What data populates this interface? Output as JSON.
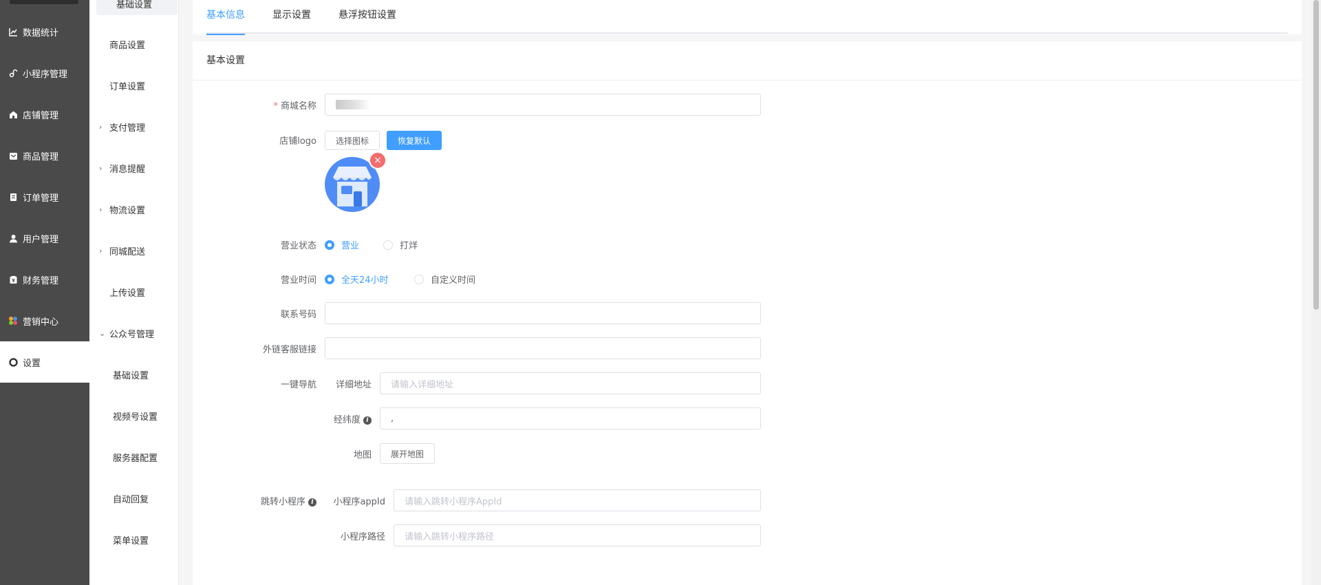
{
  "sidebar": {
    "items": [
      {
        "label": "数据统计",
        "icon": "chart-line-icon"
      },
      {
        "label": "小程序管理",
        "icon": "link-icon"
      },
      {
        "label": "店铺管理",
        "icon": "store-icon"
      },
      {
        "label": "商品管理",
        "icon": "product-icon"
      },
      {
        "label": "订单管理",
        "icon": "order-icon"
      },
      {
        "label": "用户管理",
        "icon": "user-icon"
      },
      {
        "label": "财务管理",
        "icon": "finance-icon"
      },
      {
        "label": "营销中心",
        "icon": "marketing-icon"
      },
      {
        "label": "设置",
        "icon": "gear-icon"
      }
    ]
  },
  "subnav": {
    "selected": "基础设置",
    "items": [
      "商品设置",
      "订单设置",
      "支付管理",
      "消息提醒",
      "物流设置",
      "同城配送",
      "上传设置",
      "公众号管理",
      "基础设置",
      "视频号设置",
      "服务器配置",
      "自动回复",
      "菜单设置"
    ]
  },
  "tabs": [
    "基本信息",
    "显示设置",
    "悬浮按钮设置"
  ],
  "card_title": "基本设置",
  "form": {
    "shop_name_label": "商城名称",
    "logo_label": "店铺logo",
    "choose_icon_btn": "选择图标",
    "restore_default_btn": "恢复默认",
    "status_label": "营业状态",
    "status_open": "营业",
    "status_closed": "打烊",
    "hours_label": "营业时间",
    "hours_all_day": "全天24小时",
    "hours_custom": "自定义时间",
    "phone_label": "联系号码",
    "cs_link_label": "外链客服链接",
    "nav_label": "一键导航",
    "address_label": "详细地址",
    "address_placeholder": "请输入详细地址",
    "latlng_label": "经纬度",
    "latlng_value": ",",
    "map_label": "地图",
    "map_btn": "展开地图",
    "jump_label": "跳转小程序",
    "appid_label": "小程序appId",
    "appid_placeholder": "请输入跳转小程序AppId",
    "path_label": "小程序路径",
    "path_placeholder": "请输入跳转小程序路径"
  },
  "colors": {
    "primary": "#409eff",
    "sidebar": "#4a4a4a",
    "danger": "#f56c6c"
  }
}
